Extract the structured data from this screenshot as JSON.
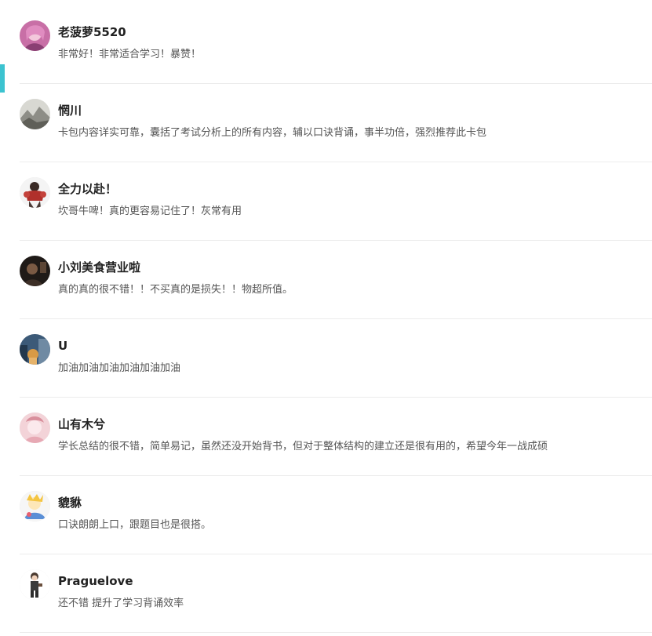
{
  "reviews": [
    {
      "user": "老菠萝5520",
      "comment": "非常好！非常适合学习！暴赞！",
      "avatar_icon": "user-avatar-pink-hair-icon",
      "avatar_bg": "#c86fa6",
      "avatar_fg": "#f3c8dc"
    },
    {
      "user": "惘川",
      "comment": "卡包内容详实可靠，囊括了考试分析上的所有内容，辅以口诀背诵，事半功倍，强烈推荐此卡包",
      "avatar_icon": "user-avatar-landscape-icon",
      "avatar_bg": "#b9b9b3",
      "avatar_fg": "#6f6f68"
    },
    {
      "user": "全力以赴！",
      "comment": "坎哥牛啤！真的更容易记住了！灰常有用",
      "avatar_icon": "user-avatar-fighter-icon",
      "avatar_bg": "#f1f1f1",
      "avatar_fg": "#b0302b"
    },
    {
      "user": "小刘美食营业啦",
      "comment": "真的真的很不错！！不买真的是损失！！物超所值。",
      "avatar_icon": "user-avatar-dark-photo-icon",
      "avatar_bg": "#2b241f",
      "avatar_fg": "#7a5a44"
    },
    {
      "user": "U",
      "comment": "加油加油加油加油加油加油",
      "avatar_icon": "user-avatar-city-photo-icon",
      "avatar_bg": "#3c5a78",
      "avatar_fg": "#d89a45"
    },
    {
      "user": "山有木兮",
      "comment": "学长总结的很不错，简单易记，虽然还没开始背书，但对于整体结构的建立还是很有用的，希望今年一战成硕",
      "avatar_icon": "user-avatar-pink-illustration-icon",
      "avatar_bg": "#f3d3d8",
      "avatar_fg": "#d98f9c"
    },
    {
      "user": "貔貅",
      "comment": "口诀朗朗上口，跟题目也是很搭。",
      "avatar_icon": "user-avatar-cartoon-icon",
      "avatar_bg": "#f6f6f6",
      "avatar_fg": "#5a8fd6"
    },
    {
      "user": "Praguelove",
      "comment": "还不错 提升了学习背诵效率",
      "avatar_icon": "user-avatar-figure-icon",
      "avatar_bg": "#ffffff",
      "avatar_fg": "#4a3a30"
    }
  ],
  "colors": {
    "accent": "#3cc3d0",
    "divider": "#ececec",
    "name_text": "#222222",
    "comment_text": "#555555"
  }
}
